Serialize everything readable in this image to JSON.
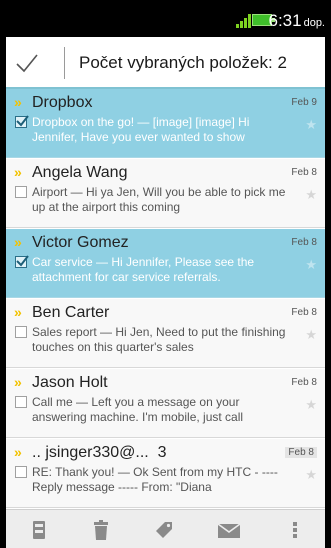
{
  "status_bar": {
    "time": "6:31",
    "ampm": "dop."
  },
  "action_bar": {
    "title": "Počet vybraných položek: 2"
  },
  "messages": [
    {
      "sender": "Dropbox",
      "date": "Feb 9",
      "preview": "Dropbox on the go! — [image] [image] Hi Jennifer, Have you ever wanted to show",
      "selected": true
    },
    {
      "sender": "Angela Wang",
      "date": "Feb 8",
      "preview": "Airport — Hi ya Jen, Will you be able to pick me up at the airport this coming",
      "selected": false
    },
    {
      "sender": "Victor Gomez",
      "date": "Feb 8",
      "preview": "Car service — Hi Jennifer, Please see the attachment for car service referrals.",
      "selected": true
    },
    {
      "sender": "Ben Carter",
      "date": "Feb 8",
      "preview": "Sales report — Hi Jen, Need to put the finishing touches on this quarter's sales",
      "selected": false
    },
    {
      "sender": "Jason Holt",
      "date": "Feb 8",
      "preview": "Call me — Left you a message on your answering machine. I'm mobile, just call",
      "selected": false
    },
    {
      "sender": ".. jsinger330@...",
      "count": "3",
      "date": "Feb 8",
      "preview": "RE: Thank you! — Ok Sent from my HTC - ---- Reply message ----- From: \"Diana",
      "selected": false
    }
  ],
  "bottom_bar": {
    "icons": [
      "move-to-folder-icon",
      "delete-icon",
      "label-icon",
      "mark-read-icon",
      "overflow-menu-icon"
    ]
  },
  "colors": {
    "selected_row": "#8fd0e3",
    "accent_chevron": "#f2c200"
  }
}
